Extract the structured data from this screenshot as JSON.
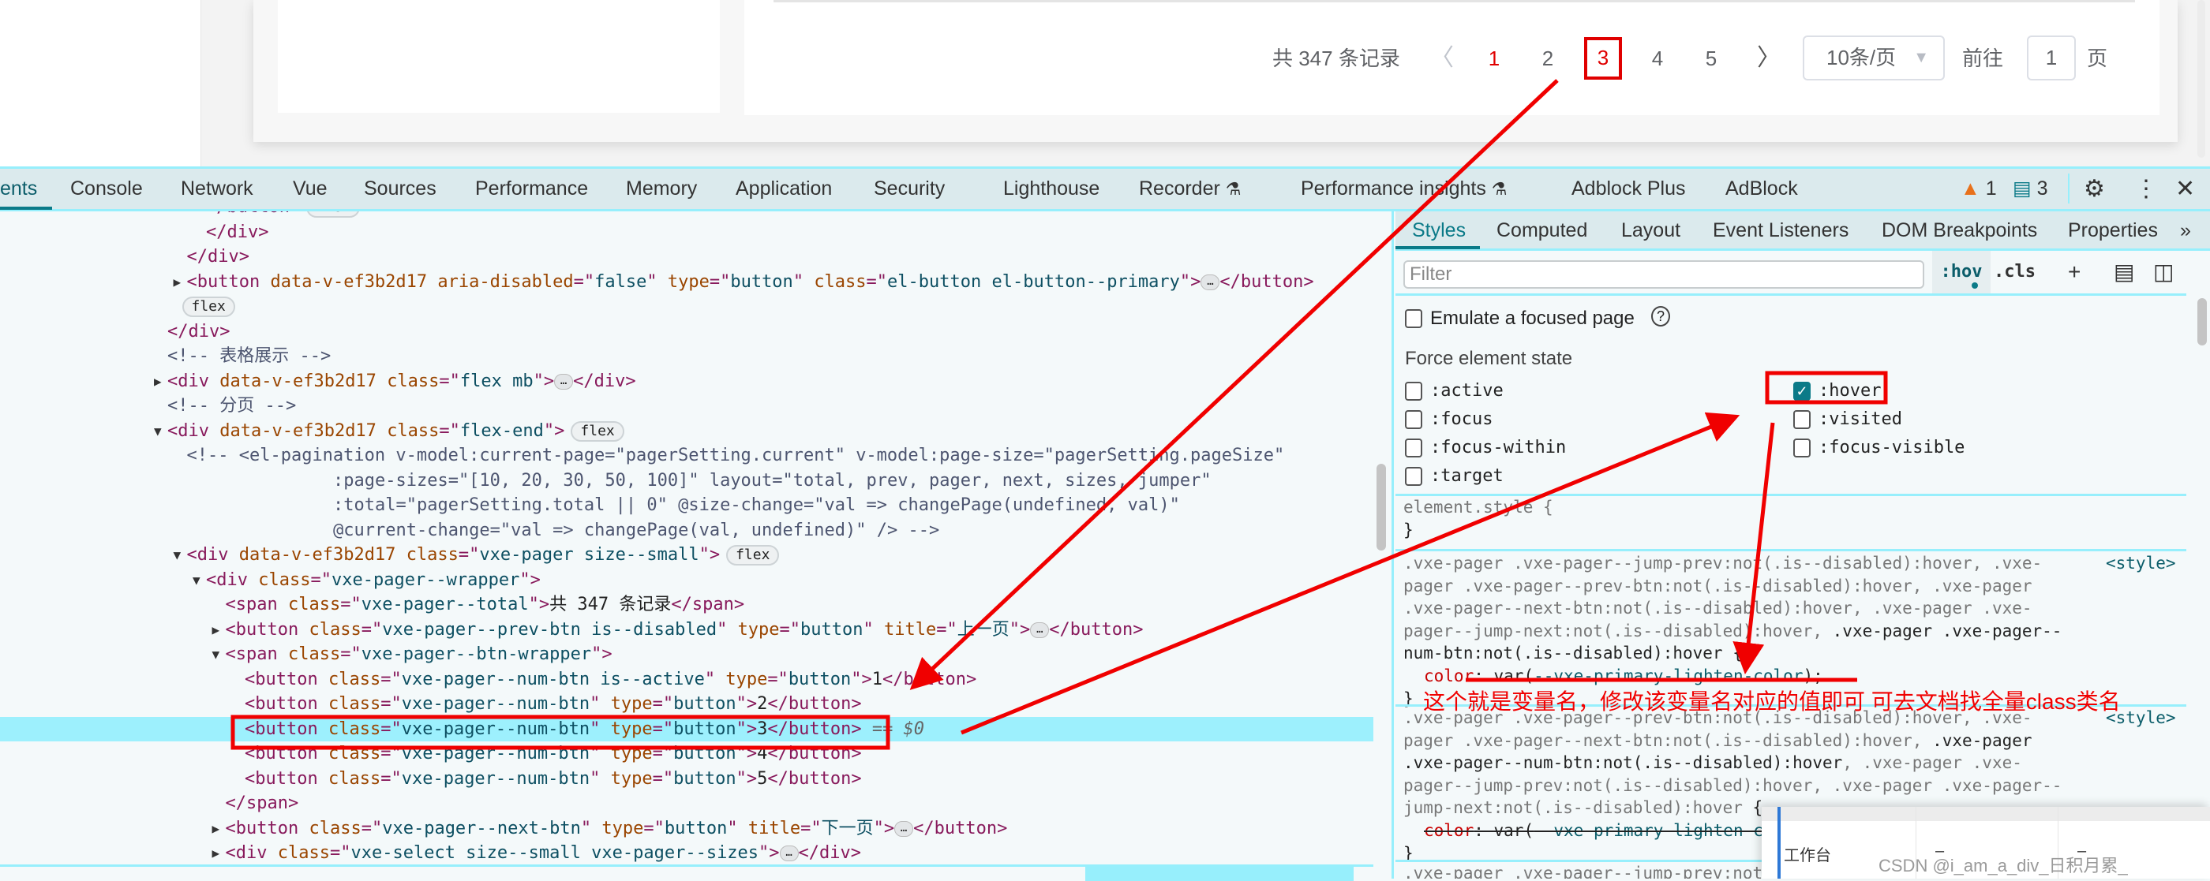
{
  "page": {
    "pager": {
      "total_label": "共 347 条记录",
      "prev_icon": "chevron-left",
      "next_icon": "chevron-right",
      "pages": [
        "1",
        "2",
        "3",
        "4",
        "5"
      ],
      "current_page": "1",
      "hovered_page": "3",
      "page_size": "10条/页",
      "goto_label": "前往",
      "goto_value": "1",
      "page_suffix": "页"
    }
  },
  "devtools": {
    "tabs": [
      "ents",
      "Console",
      "Network",
      "Vue",
      "Sources",
      "Performance",
      "Memory",
      "Application",
      "Security",
      "Lighthouse",
      "Recorder",
      "Performance insights",
      "Adblock Plus",
      "AdBlock"
    ],
    "active_tab": "ents",
    "warnings_count": "1",
    "messages_count": "3",
    "accent_color": "#0b7a88"
  },
  "dom_tree": [
    {
      "kind": "close",
      "depth": 2,
      "tag": "</button>",
      "badge": "flex"
    },
    {
      "kind": "close",
      "depth": 2,
      "tag": "</div>"
    },
    {
      "kind": "close",
      "depth": 1,
      "tag": "</div>"
    },
    {
      "kind": "open",
      "depth": 1,
      "arrow": "right",
      "tag": "button",
      "attrs": [
        [
          "data-v-ef3b2d17",
          null
        ],
        [
          "aria-disabled",
          "false"
        ],
        [
          "type",
          "button"
        ],
        [
          "class",
          "el-button el-button--primary"
        ]
      ],
      "collapsed": true,
      "close": "</button>"
    },
    {
      "kind": "badge",
      "depth": 1,
      "badge": "flex"
    },
    {
      "kind": "close",
      "depth": 0,
      "tag": "</div>"
    },
    {
      "kind": "comment",
      "depth": 0,
      "text": "<!-- 表格展示 -->"
    },
    {
      "kind": "open",
      "depth": 0,
      "arrow": "right",
      "tag": "div",
      "attrs": [
        [
          "data-v-ef3b2d17",
          null
        ],
        [
          "class",
          "flex mb"
        ]
      ],
      "collapsed": true,
      "close": "</div>"
    },
    {
      "kind": "comment",
      "depth": 0,
      "text": "<!-- 分页 -->"
    },
    {
      "kind": "open",
      "depth": 0,
      "arrow": "down",
      "tag": "div",
      "attrs": [
        [
          "data-v-ef3b2d17",
          null
        ],
        [
          "class",
          "flex-end"
        ]
      ],
      "badge": "flex"
    },
    {
      "kind": "comment",
      "depth": 1,
      "text": "<!-- <el-pagination v-model:current-page=\"pagerSetting.current\" v-model:page-size=\"pagerSetting.pageSize\""
    },
    {
      "kind": "comment",
      "cont": true,
      "text": ":page-sizes=\"[10, 20, 30, 50, 100]\" layout=\"total, prev, pager, next, sizes, jumper\""
    },
    {
      "kind": "comment",
      "cont": true,
      "text": ":total=\"pagerSetting.total || 0\" @size-change=\"val => changePage(undefined, val)\""
    },
    {
      "kind": "comment",
      "cont": true,
      "text": "@current-change=\"val => changePage(val, undefined)\" /> -->"
    },
    {
      "kind": "open",
      "depth": 1,
      "arrow": "down",
      "tag": "div",
      "attrs": [
        [
          "data-v-ef3b2d17",
          null
        ],
        [
          "class",
          "vxe-pager size--small"
        ]
      ],
      "badge": "flex"
    },
    {
      "kind": "open",
      "depth": 2,
      "arrow": "down",
      "tag": "div",
      "attrs": [
        [
          "class",
          "vxe-pager--wrapper"
        ]
      ]
    },
    {
      "kind": "open",
      "depth": 3,
      "tag": "span",
      "attrs": [
        [
          "class",
          "vxe-pager--total"
        ]
      ],
      "text": "共 347 条记录",
      "close": "</span>"
    },
    {
      "kind": "open",
      "depth": 3,
      "arrow": "right",
      "tag": "button",
      "attrs": [
        [
          "class",
          "vxe-pager--prev-btn is--disabled"
        ],
        [
          "type",
          "button"
        ],
        [
          "title",
          "上一页"
        ]
      ],
      "collapsed": true,
      "close": "</button>"
    },
    {
      "kind": "open",
      "depth": 3,
      "arrow": "down",
      "tag": "span",
      "attrs": [
        [
          "class",
          "vxe-pager--btn-wrapper"
        ]
      ]
    },
    {
      "kind": "open",
      "depth": 4,
      "tag": "button",
      "attrs": [
        [
          "class",
          "vxe-pager--num-btn is--active"
        ],
        [
          "type",
          "button"
        ]
      ],
      "text": "1",
      "close": "</button>"
    },
    {
      "kind": "open",
      "depth": 4,
      "tag": "button",
      "attrs": [
        [
          "class",
          "vxe-pager--num-btn"
        ],
        [
          "type",
          "button"
        ]
      ],
      "text": "2",
      "close": "</button>"
    },
    {
      "kind": "open",
      "depth": 4,
      "tag": "button",
      "attrs": [
        [
          "class",
          "vxe-pager--num-btn"
        ],
        [
          "type",
          "button"
        ]
      ],
      "text": "3",
      "close": "</button>",
      "selected": true,
      "suffix": " == $0"
    },
    {
      "kind": "open",
      "depth": 4,
      "tag": "button",
      "attrs": [
        [
          "class",
          "vxe-pager--num-btn"
        ],
        [
          "type",
          "button"
        ]
      ],
      "text": "4",
      "close": "</button>"
    },
    {
      "kind": "open",
      "depth": 4,
      "tag": "button",
      "attrs": [
        [
          "class",
          "vxe-pager--num-btn"
        ],
        [
          "type",
          "button"
        ]
      ],
      "text": "5",
      "close": "</button>"
    },
    {
      "kind": "close",
      "depth": 3,
      "tag": "</span>"
    },
    {
      "kind": "open",
      "depth": 3,
      "arrow": "right",
      "tag": "button",
      "attrs": [
        [
          "class",
          "vxe-pager--next-btn"
        ],
        [
          "type",
          "button"
        ],
        [
          "title",
          "下一页"
        ]
      ],
      "collapsed": true,
      "close": "</button>"
    },
    {
      "kind": "open",
      "depth": 3,
      "arrow": "right",
      "tag": "div",
      "attrs": [
        [
          "class",
          "vxe-select size--small vxe-pager--sizes"
        ]
      ],
      "collapsed": true,
      "close": "</div>"
    }
  ],
  "styles_panel": {
    "tabs": [
      "Styles",
      "Computed",
      "Layout",
      "Event Listeners",
      "DOM Breakpoints",
      "Properties"
    ],
    "more_icon": "»",
    "active_tab": "Styles",
    "filter_placeholder": "Filter",
    "hov_label": ":hov",
    "cls_label": ".cls",
    "emulate_focused_label": "Emulate a focused page",
    "force_state_heading": "Force element state",
    "states": [
      {
        "label": ":active",
        "checked": false
      },
      {
        "label": ":hover",
        "checked": true
      },
      {
        "label": ":focus",
        "checked": false
      },
      {
        "label": ":visited",
        "checked": false
      },
      {
        "label": ":focus-within",
        "checked": false
      },
      {
        "label": ":focus-visible",
        "checked": false
      },
      {
        "label": ":target",
        "checked": false
      }
    ],
    "element_style": {
      "selector": "element.style {",
      "close": "}"
    },
    "rules": [
      {
        "source": "<style>",
        "selector": [
          [
            ".vxe-pager .vxe-pager--jump-prev:not(.is--disabled):hover, .vxe-pager .vxe-pager--prev-btn:not(.is--disabled):hover, .vxe-pager .vxe-pager--next-btn:not(.is--disabled):hover, .vxe-pager .vxe-pager--jump-next:not(.is--disabled):hover, ",
            false
          ],
          [
            ".vxe-pager .vxe-pager--num-btn:not(.is--disabled):hover",
            true
          ],
          [
            " {",
            true
          ]
        ],
        "prop": "color",
        "value_prefix": "var(",
        "variable": "--vxe-primary-lighten-color",
        "value_suffix": ");",
        "overridden": false,
        "close": "}"
      },
      {
        "source": "<style>",
        "selector": [
          [
            ".vxe-pager .vxe-pager--prev-btn:not(.is--disabled):hover, .vxe-pager .vxe-pager--next-btn:not(.is--disabled):hover, ",
            false
          ],
          [
            ".vxe-pager .vxe-pager--num-btn:not(.is--disabled):hover",
            true
          ],
          [
            ", .vxe-pager .vxe-pager--jump-prev:not(.is--disabled):hover, .vxe-pager .vxe-pager--jump-next:not(.is--disabled):hover",
            false
          ],
          [
            " {",
            true
          ]
        ],
        "prop": "color",
        "value_prefix": "var(",
        "variable": "--vxe-primary-lighten-color",
        "value_suffix": ");",
        "overridden": true,
        "close": "}"
      }
    ],
    "partial_rule": ".vxe-pager .vxe-pager--jump-prev:not(.is--disabled):hover"
  },
  "annotation": {
    "text": "这个就是变量名，修改该变量名对应的值即可  可去文档找全量class类名",
    "color": "#f00000"
  },
  "overlay_window": {
    "cell_label": "工作台",
    "col2": "–",
    "col3": "–"
  },
  "watermark": "CSDN @i_am_a_div_日积月累_"
}
